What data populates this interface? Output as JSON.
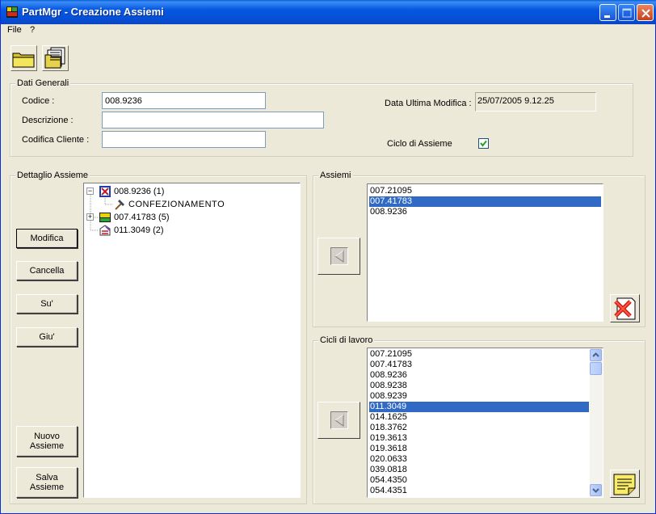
{
  "window": {
    "title": "PartMgr - Creazione Assiemi",
    "colors": {
      "titlebar": "#0757e0",
      "face": "#ece9d8",
      "selection": "#316ac5"
    }
  },
  "menu": {
    "items": [
      "File",
      "?"
    ]
  },
  "toolbar": {
    "icons": [
      "open-folder-icon",
      "document-list-icon"
    ]
  },
  "general": {
    "legend": "Dati Generali",
    "codice_label": "Codice :",
    "codice_value": "008.9236",
    "descrizione_label": "Descrizione :",
    "descrizione_value": "",
    "codifica_label": "Codifica Cliente :",
    "codifica_value": "",
    "data_label": "Data Ultima Modifica :",
    "data_value": "25/07/2005 9.12.25",
    "ciclo_label": "Ciclo di Assieme",
    "ciclo_checked": true
  },
  "detail": {
    "legend": "Dettaglio Assieme",
    "buttons": {
      "modifica": "Modifica",
      "cancella": "Cancella",
      "su": "Su'",
      "giu": "Giu'",
      "nuovo_line1": "Nuovo",
      "nuovo_line2": "Assieme",
      "salva_line1": "Salva",
      "salva_line2": "Assieme"
    },
    "tree": [
      {
        "label": "008.9236 (1)",
        "expander": "−",
        "icon": "assembly-icon"
      },
      {
        "label": "CONFEZIONAMENTO",
        "icon": "hammer-icon"
      },
      {
        "label": "007.41783 (5)",
        "expander": "+",
        "icon": "component-icon"
      },
      {
        "label": "011.3049 (2)",
        "icon": "cycle-icon"
      }
    ]
  },
  "assiemi": {
    "legend": "Assiemi",
    "items": [
      "007.21095",
      "007.41783",
      "008.9236"
    ],
    "selected_index": 1
  },
  "cicli": {
    "legend": "Cicli di lavoro",
    "items": [
      "007.21095",
      "007.41783",
      "008.9236",
      "008.9238",
      "008.9239",
      "011.3049",
      "014.1625",
      "018.3762",
      "019.3613",
      "019.3618",
      "020.0633",
      "039.0818",
      "054.4350",
      "054.4351"
    ],
    "selected_index": 5
  }
}
